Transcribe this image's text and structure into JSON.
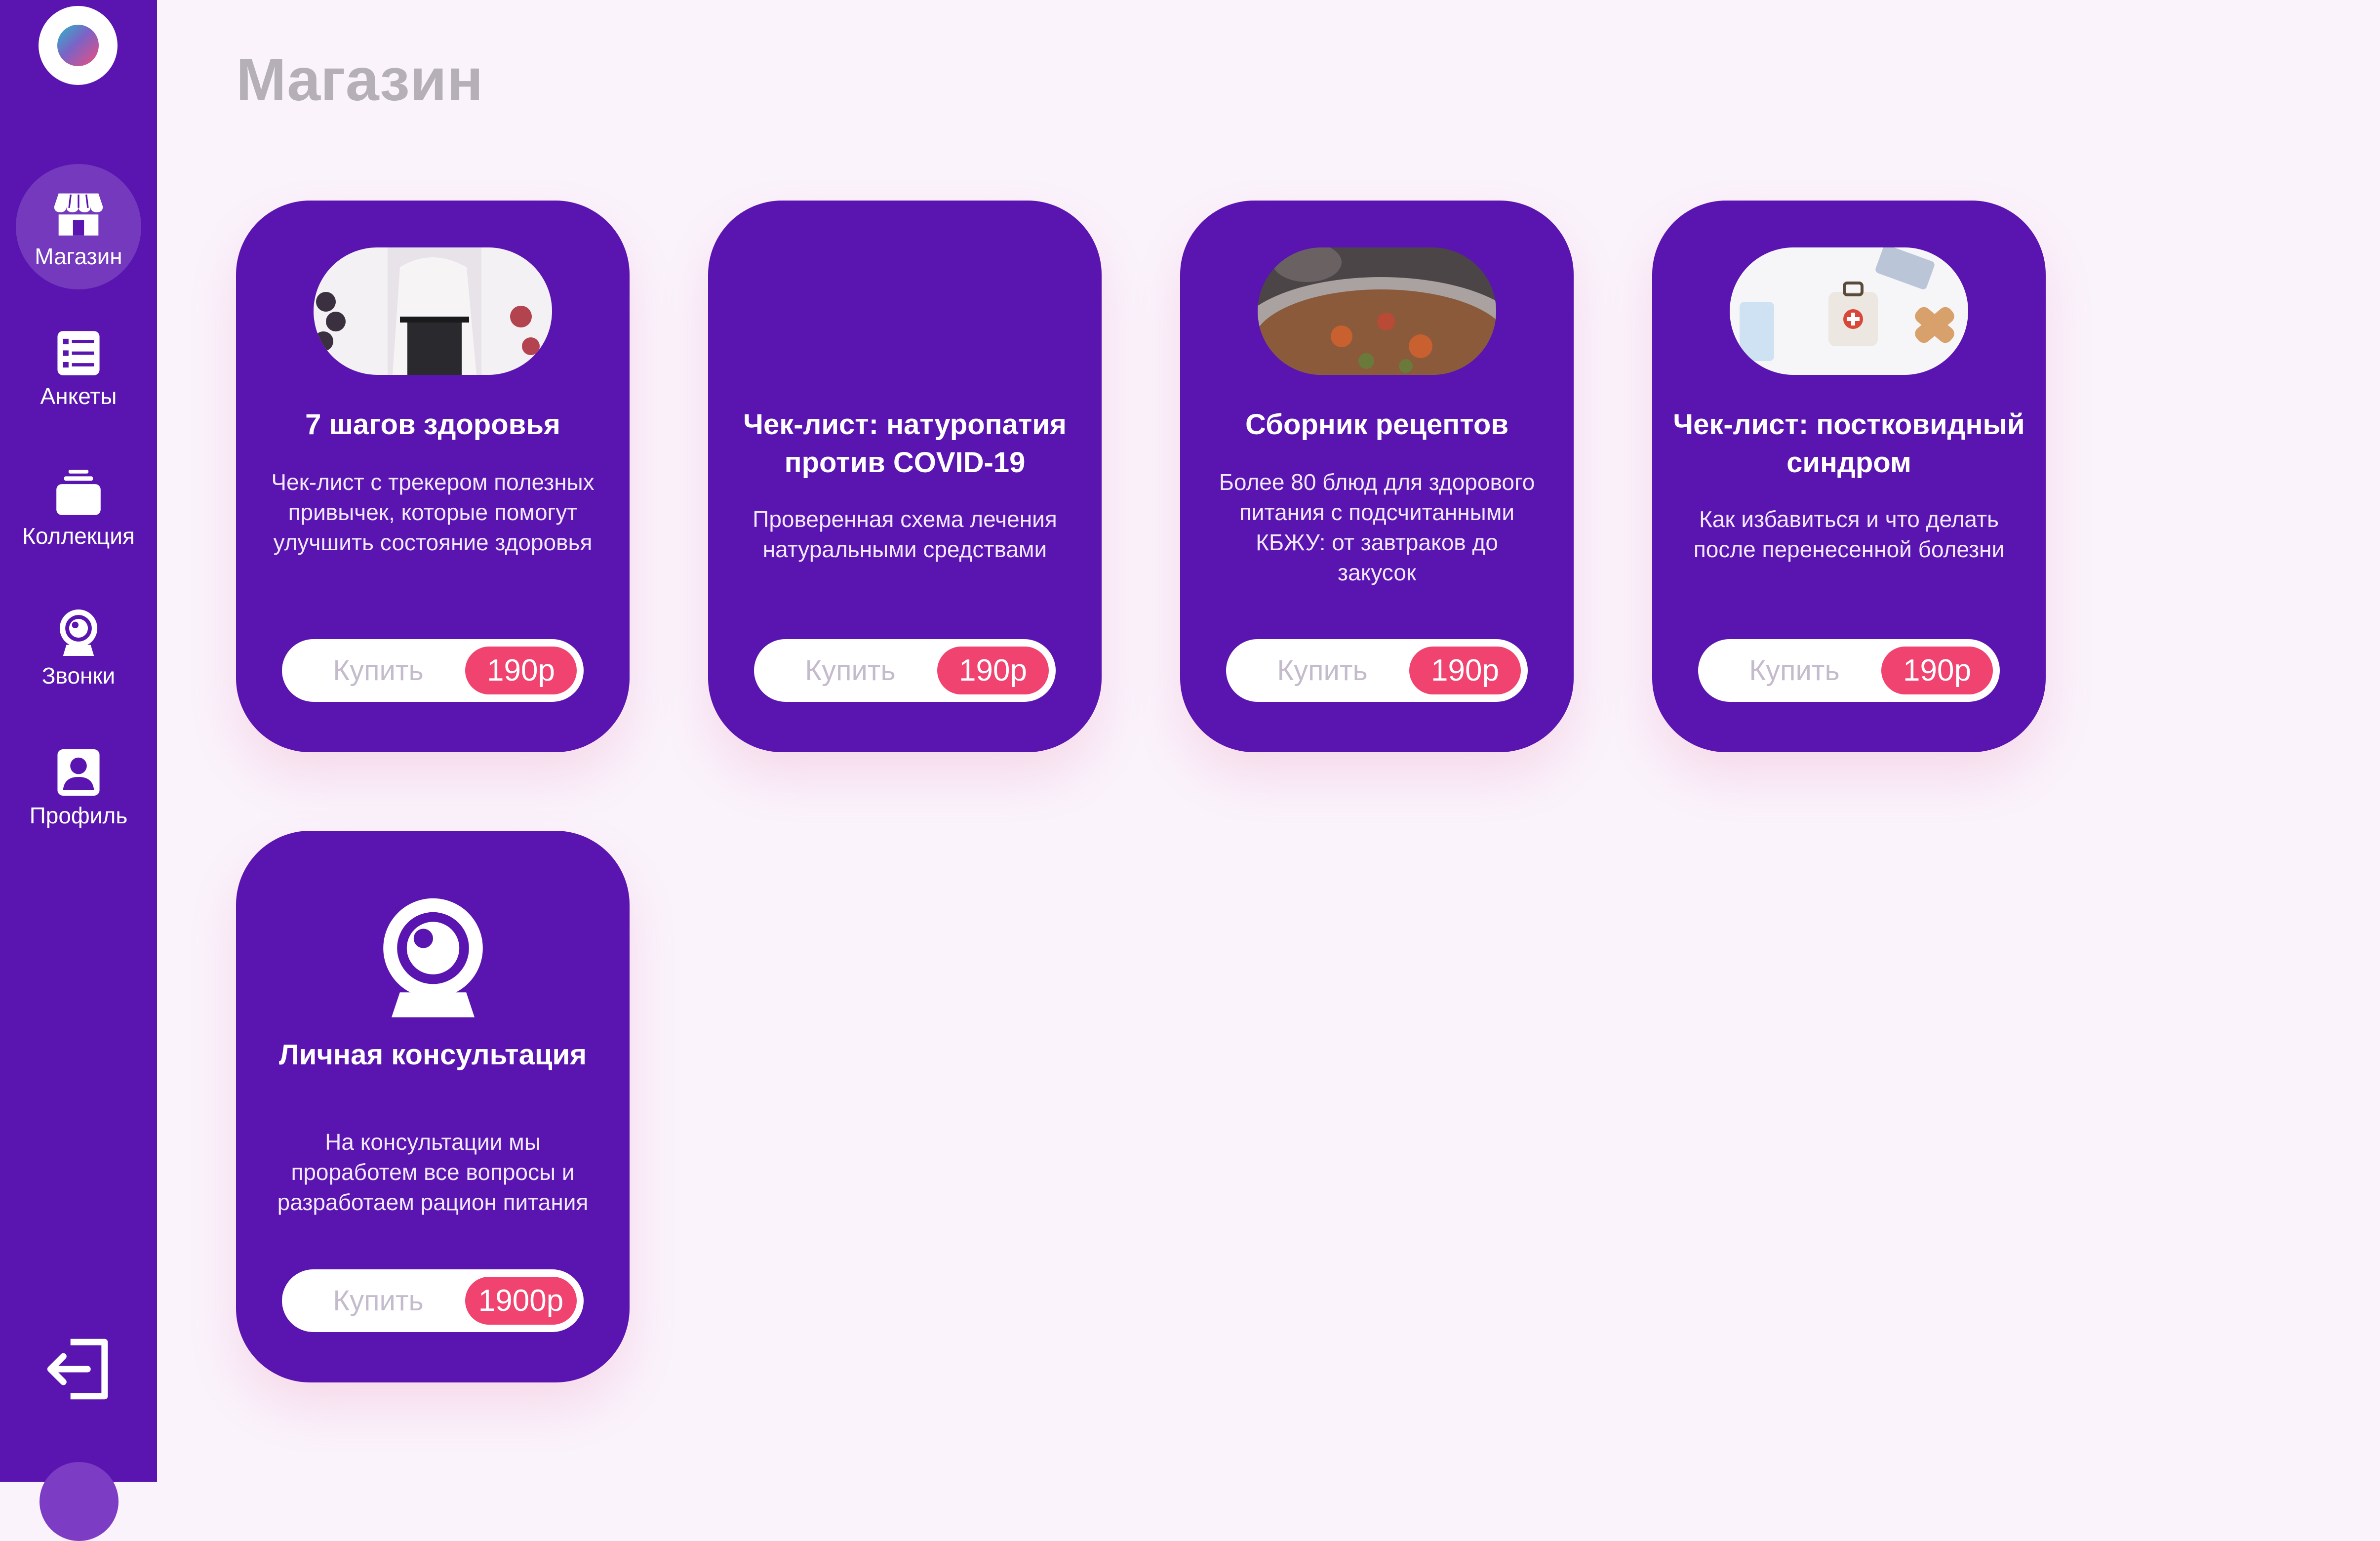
{
  "page": {
    "title": "Магазин"
  },
  "sidebar": {
    "items": [
      {
        "label": "Магазин",
        "icon": "store-icon",
        "active": true
      },
      {
        "label": "Анкеты",
        "icon": "list-icon",
        "active": false
      },
      {
        "label": "Коллекция",
        "icon": "collection-icon",
        "active": false
      },
      {
        "label": "Звонки",
        "icon": "webcam-icon",
        "active": false
      },
      {
        "label": "Профиль",
        "icon": "profile-icon",
        "active": false
      }
    ],
    "logout_icon": "logout-icon"
  },
  "products": [
    {
      "title": "7 шагов здоровья",
      "description": "Чек-лист с трекером полезных привычек, которые помогут улучшить состояние здоровья",
      "buy_label": "Купить",
      "price": "190р",
      "media": "photo"
    },
    {
      "title": "Чек-лист: натуропатия против COVID-19",
      "description": "Проверенная схема лечения натуральными средствами",
      "buy_label": "Купить",
      "price": "190р",
      "media": "none"
    },
    {
      "title": "Сборник рецептов",
      "description": "Более 80 блюд для здорового питания с подсчитанными КБЖУ: от завтраков до закусок",
      "buy_label": "Купить",
      "price": "190р",
      "media": "photo"
    },
    {
      "title": "Чек-лист: постковидный синдром",
      "description": "Как избавиться и что делать после перенесенной болезни",
      "buy_label": "Купить",
      "price": "190р",
      "media": "photo"
    },
    {
      "title": "Личная консультация",
      "description": "На консультации мы проработем все вопросы и разработаем рацион питания",
      "buy_label": "Купить",
      "price": "1900р",
      "media": "webcam-icon"
    }
  ],
  "colors": {
    "sidebar_bg": "#5a14b0",
    "card_bg": "#5a14b0",
    "price_bg": "#f0436f",
    "page_bg": "#faf3fc",
    "title_text": "#b5b0b8"
  }
}
